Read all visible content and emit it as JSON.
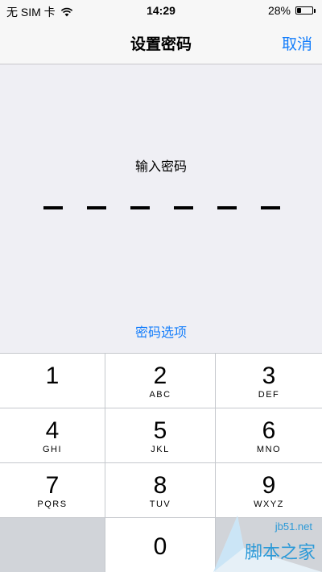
{
  "status_bar": {
    "carrier": "无 SIM 卡",
    "time": "14:29",
    "battery": "28%",
    "battery_level": 0.28
  },
  "nav": {
    "title": "设置密码",
    "cancel": "取消"
  },
  "passcode": {
    "prompt": "输入密码",
    "length": 6,
    "options": "密码选项"
  },
  "keypad": {
    "keys": [
      {
        "num": "1",
        "letters": ""
      },
      {
        "num": "2",
        "letters": "ABC"
      },
      {
        "num": "3",
        "letters": "DEF"
      },
      {
        "num": "4",
        "letters": "GHI"
      },
      {
        "num": "5",
        "letters": "JKL"
      },
      {
        "num": "6",
        "letters": "MNO"
      },
      {
        "num": "7",
        "letters": "PQRS"
      },
      {
        "num": "8",
        "letters": "TUV"
      },
      {
        "num": "9",
        "letters": "WXYZ"
      },
      {
        "num": "0",
        "letters": ""
      }
    ]
  },
  "watermark": {
    "url": "jb51.net",
    "text": "脚本之家"
  },
  "colors": {
    "accent": "#157efb",
    "background": "#efeff4",
    "keypad_bg": "#c5c8cd"
  }
}
